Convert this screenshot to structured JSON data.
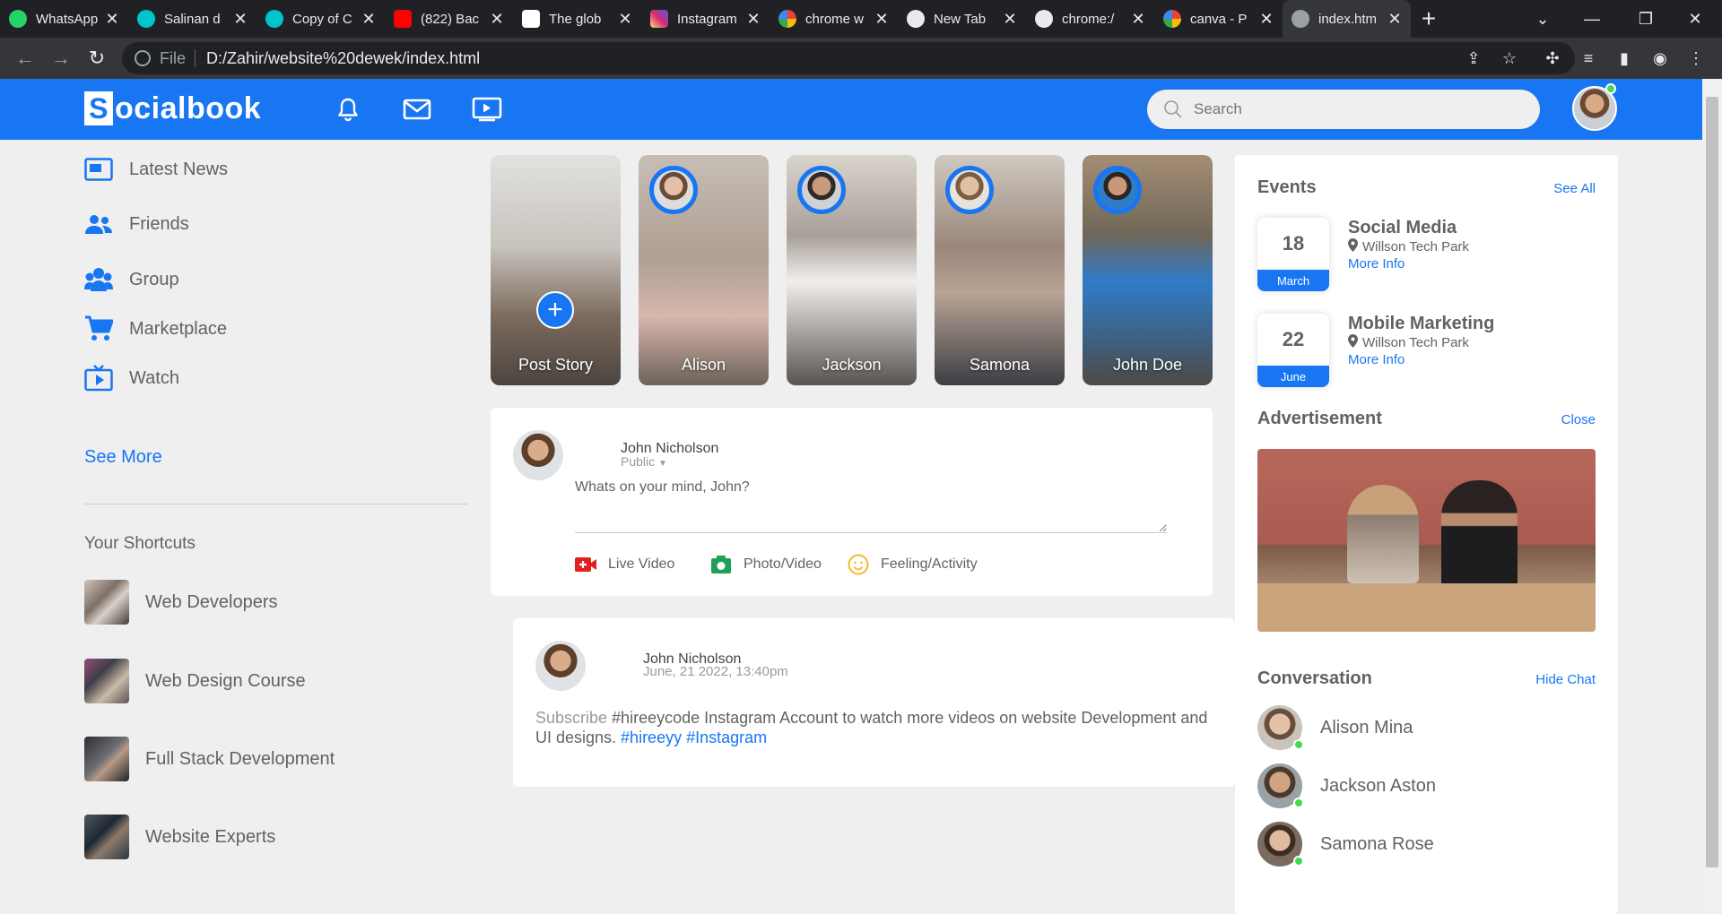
{
  "browser": {
    "tabs": [
      {
        "title": "WhatsApp",
        "icon": "whatsapp-icon",
        "color": "#25d366"
      },
      {
        "title": "Salinan d",
        "icon": "canva-icon",
        "color": "#00c4cc"
      },
      {
        "title": "Copy of C",
        "icon": "canva-icon",
        "color": "#00c4cc"
      },
      {
        "title": "(822) Bac",
        "icon": "youtube-icon",
        "color": "#ff0000"
      },
      {
        "title": "The glob",
        "icon": "w3schools-icon",
        "color": "#04aa6d"
      },
      {
        "title": "Instagram",
        "icon": "instagram-icon",
        "color": "#d62976"
      },
      {
        "title": "chrome w",
        "icon": "google-icon",
        "color": "#4285f4"
      },
      {
        "title": "New Tab",
        "icon": "chrome-icon",
        "color": "#9aa0a6"
      },
      {
        "title": "chrome:/",
        "icon": "chrome-icon",
        "color": "#9aa0a6"
      },
      {
        "title": "canva - P",
        "icon": "google-icon",
        "color": "#4285f4"
      },
      {
        "title": "index.htm",
        "icon": "globe-icon",
        "color": "#9aa0a6"
      }
    ],
    "address": {
      "protocol": "File",
      "url": "D:/Zahir/website%20dewek/index.html"
    }
  },
  "navbar": {
    "logo_letter": "S",
    "logo_text": "ocialbook",
    "search_placeholder": "Search",
    "accent": "#1876f2"
  },
  "sidebar": {
    "items": [
      {
        "label": "Latest News",
        "icon": "news-icon"
      },
      {
        "label": "Friends",
        "icon": "friends-icon"
      },
      {
        "label": "Group",
        "icon": "group-icon"
      },
      {
        "label": "Marketplace",
        "icon": "cart-icon"
      },
      {
        "label": "Watch",
        "icon": "watch-icon"
      }
    ],
    "see_more": "See More",
    "shortcuts_title": "Your Shortcuts",
    "shortcuts": [
      {
        "label": "Web Developers"
      },
      {
        "label": "Web Design Course"
      },
      {
        "label": "Full Stack Development"
      },
      {
        "label": "Website Experts"
      }
    ]
  },
  "stories": [
    {
      "name": "Post Story"
    },
    {
      "name": "Alison"
    },
    {
      "name": "Jackson"
    },
    {
      "name": "Samona"
    },
    {
      "name": "John Doe"
    }
  ],
  "write_post": {
    "user_name": "John Nicholson",
    "privacy": "Public",
    "placeholder": "Whats on your mind, John?",
    "actions": [
      {
        "label": "Live Video",
        "icon": "live-video-icon"
      },
      {
        "label": "Photo/Video",
        "icon": "photo-icon"
      },
      {
        "label": "Feeling/Activity",
        "icon": "feeling-icon"
      }
    ]
  },
  "post": {
    "user_name": "John Nicholson",
    "timestamp": "June, 21 2022, 13:40pm",
    "text_muted": "Subscribe",
    "text_body": " #hireeycode Instagram Account to watch more videos on website Development and UI designs. ",
    "tag1": "#hireeyy",
    "tag2": "#Instagram"
  },
  "events": {
    "title": "Events",
    "link": "See All",
    "items": [
      {
        "day": "18",
        "month": "March",
        "title": "Social Media",
        "place": "Willson Tech Park",
        "more": "More Info"
      },
      {
        "day": "22",
        "month": "June",
        "title": "Mobile Marketing",
        "place": "Willson Tech Park",
        "more": "More Info"
      }
    ]
  },
  "advertisement": {
    "title": "Advertisement",
    "link": "Close"
  },
  "conversation": {
    "title": "Conversation",
    "link": "Hide Chat",
    "contacts": [
      {
        "name": "Alison Mina"
      },
      {
        "name": "Jackson Aston"
      },
      {
        "name": "Samona Rose"
      }
    ]
  }
}
